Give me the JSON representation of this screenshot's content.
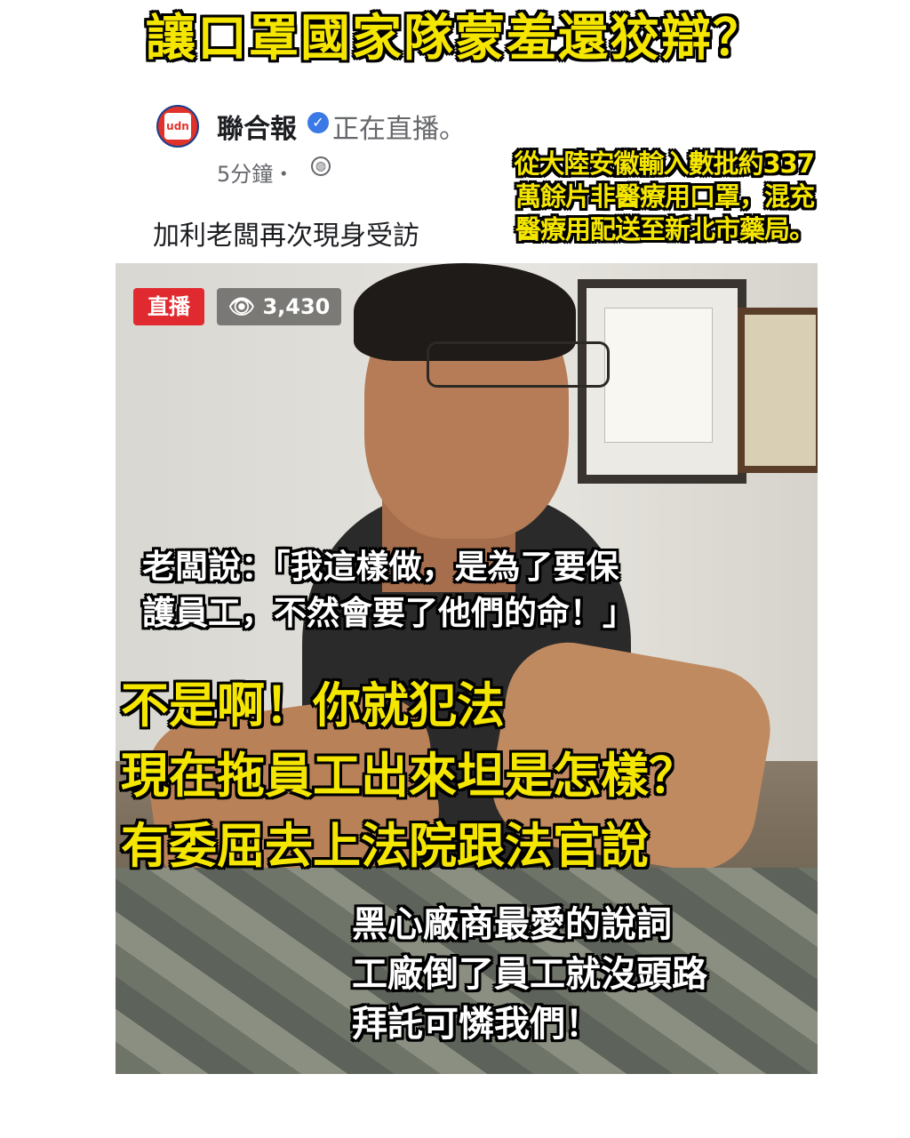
{
  "headline": "讓口罩國家隊蒙羞還狡辯？",
  "post": {
    "page_name": "聯合報",
    "live_status": "正在直播。",
    "time": "5分鐘・",
    "text": "加利老闆再次現身受訪"
  },
  "overlay_note": [
    "從大陸安徽輸入數批約337",
    "萬餘片非醫療用口罩，混充",
    "醫療用配送至新北市藥局。"
  ],
  "video": {
    "live_label": "直播",
    "views": "3,430"
  },
  "quote": [
    "老闆說：「我這樣做，是為了要保",
    "護員工，不然會要了他們的命！」"
  ],
  "rebuttal": [
    "不是啊！你就犯法",
    "現在拖員工出來坦是怎樣？",
    "有委屈去上法院跟法官說"
  ],
  "excuse": [
    "黑心廠商最愛的說詞",
    "工廠倒了員工就沒頭路",
    "拜託可憐我們！"
  ],
  "colors": {
    "highlight_yellow": "#f5e600",
    "live_red": "#e02a2f",
    "verified_blue": "#3b79e6"
  },
  "icons": [
    "verified-icon",
    "globe-icon",
    "eye-icon",
    "news-logo"
  ]
}
